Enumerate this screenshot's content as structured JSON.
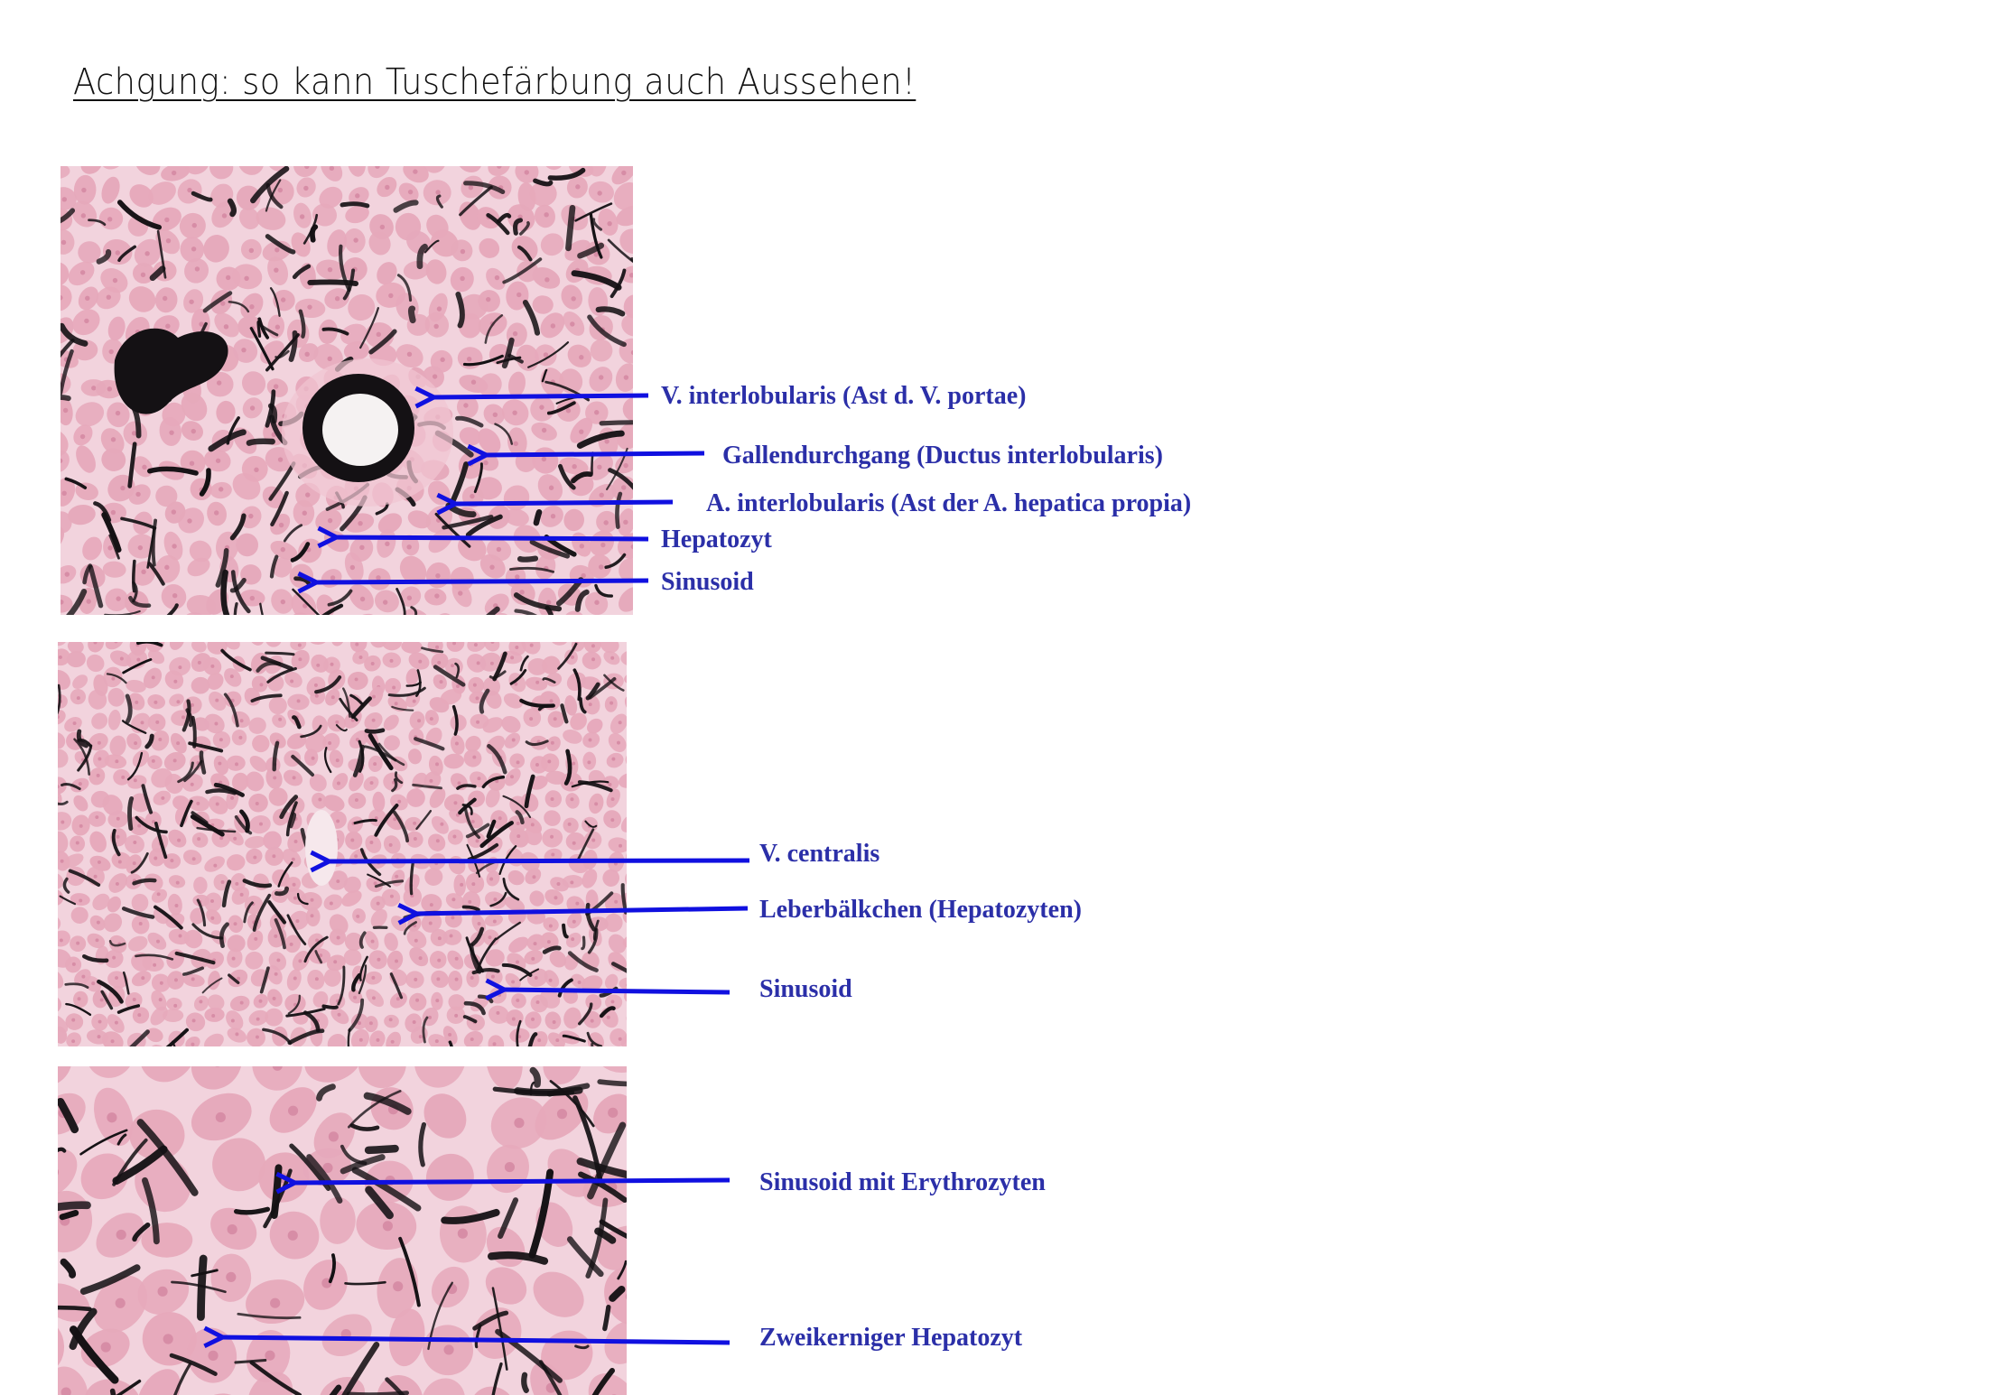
{
  "title": "Achgung: so kann Tuschefärbung auch Aussehen!",
  "colors": {
    "label_text": "#2b2fa8",
    "arrow": "#1010e0",
    "tissue_pink": "#e6a9bb",
    "ink_black": "#141114"
  },
  "panels": [
    {
      "name": "portal-field-micrograph",
      "labels": [
        "V. interlobularis (Ast d. V. portae)",
        "Gallendurchgang (Ductus interlobularis)",
        "A. interlobularis (Ast der A. hepatica propia)",
        "Hepatozyt",
        "Sinusoid"
      ]
    },
    {
      "name": "central-vein-micrograph",
      "labels": [
        "V. centralis",
        "Leberbälkchen  (Hepatozyten)",
        "Sinusoid"
      ]
    },
    {
      "name": "high-magnification-micrograph",
      "labels": [
        "Sinusoid mit Erythrozyten",
        "Zweikerniger Hepatozyt"
      ]
    }
  ]
}
